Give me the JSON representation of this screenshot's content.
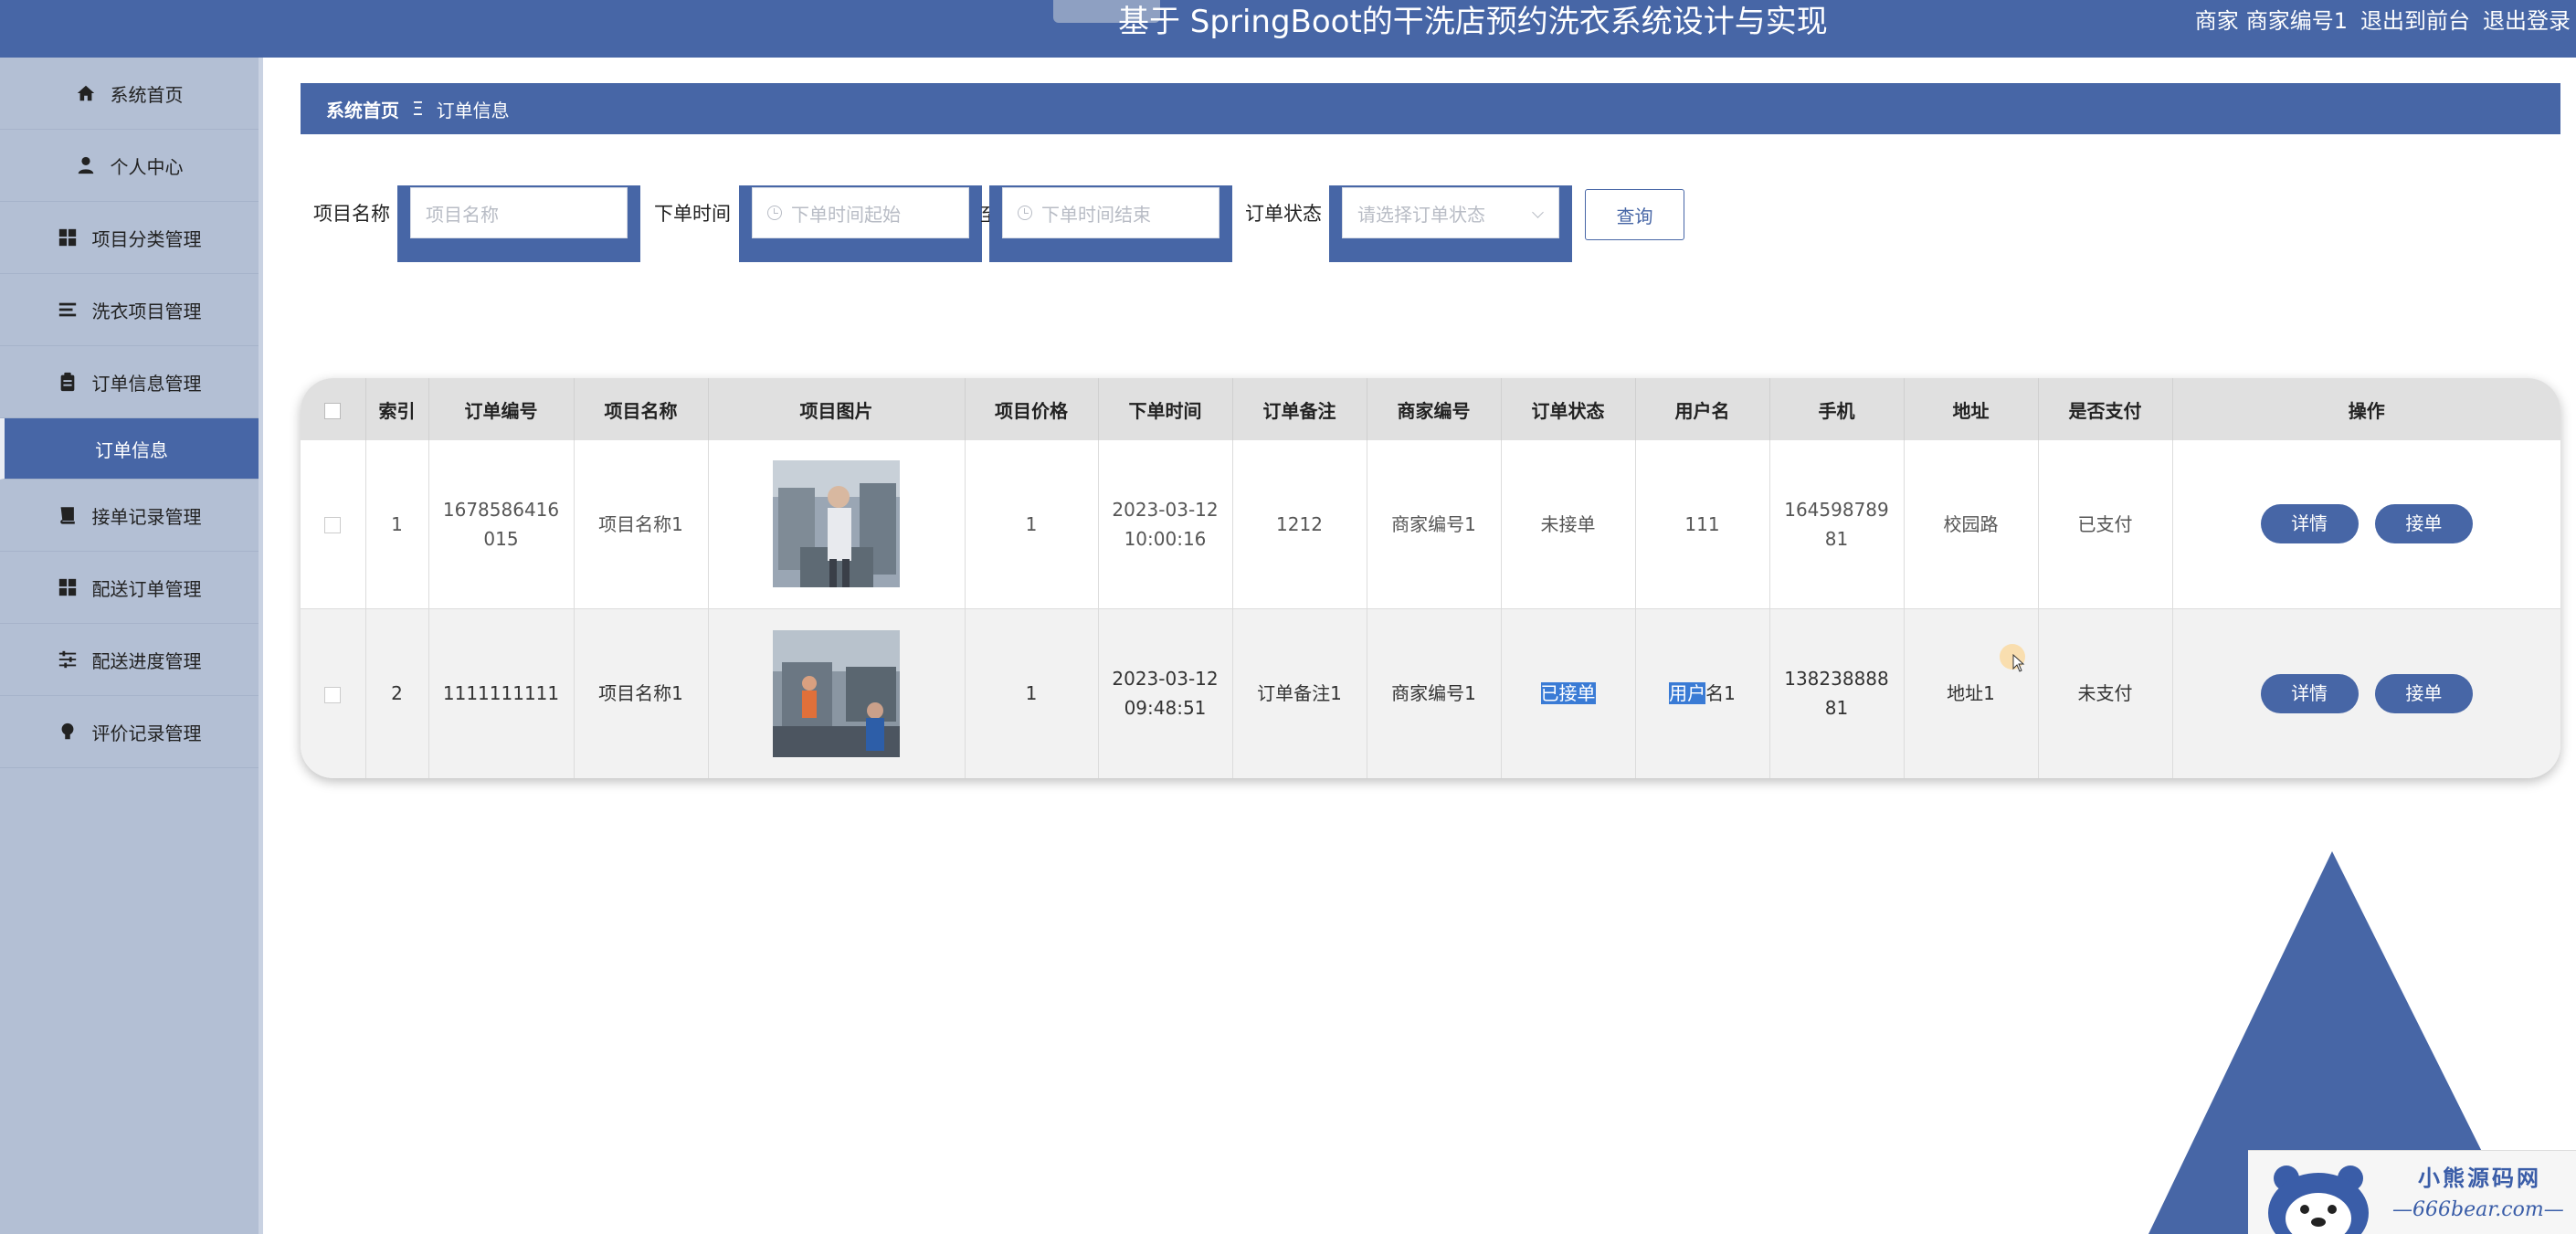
{
  "app": {
    "title": "基于 SpringBoot的干洗店预约洗衣系统设计与实现",
    "user_role": "商家",
    "user_name": "商家编号1",
    "back_to_front": "退出到前台",
    "logout": "退出登录"
  },
  "sidebar": {
    "items": [
      {
        "label": "系统首页",
        "icon": "home-icon"
      },
      {
        "label": "个人中心",
        "icon": "user-icon"
      },
      {
        "label": "项目分类管理",
        "icon": "grid-icon"
      },
      {
        "label": "洗衣项目管理",
        "icon": "list-icon"
      },
      {
        "label": "订单信息管理",
        "icon": "clipboard-icon"
      },
      {
        "label": "订单信息",
        "icon": "",
        "active": true
      },
      {
        "label": "接单记录管理",
        "icon": "book-icon"
      },
      {
        "label": "配送订单管理",
        "icon": "grid-icon"
      },
      {
        "label": "配送进度管理",
        "icon": "sliders-icon"
      },
      {
        "label": "评价记录管理",
        "icon": "bulb-icon"
      }
    ]
  },
  "breadcrumb": {
    "home": "系统首页",
    "separator": "Ξ",
    "current": "订单信息"
  },
  "search": {
    "project_label": "项目名称",
    "project_placeholder": "项目名称",
    "time_label": "下单时间",
    "time_start_placeholder": "下单时间起始",
    "time_end_placeholder": "下单时间结束",
    "status_label": "订单状态",
    "status_placeholder": "请选择订单状态",
    "query_button": "查询"
  },
  "table": {
    "columns": [
      "索引",
      "订单编号",
      "项目名称",
      "项目图片",
      "项目价格",
      "下单时间",
      "订单备注",
      "商家编号",
      "订单状态",
      "用户名",
      "手机",
      "地址",
      "是否支付",
      "操作"
    ],
    "rows": [
      {
        "index": "1",
        "order_no": "1678586416015",
        "project": "项目名称1",
        "price": "1",
        "time": "2023-03-12 10:00:16",
        "note": "1212",
        "merchant": "商家编号1",
        "status": "未接单",
        "username": "111",
        "phone": "16459878981",
        "address": "校园路",
        "paid": "已支付",
        "detail_btn": "详情",
        "accept_btn": "接单"
      },
      {
        "index": "2",
        "order_no": "1111111111",
        "project": "项目名称1",
        "price": "1",
        "time": "2023-03-12 09:48:51",
        "note": "订单备注1",
        "merchant": "商家编号1",
        "status_selected": "已接单",
        "username_selected": "用户",
        "username_rest": "名1",
        "phone": "13823888881",
        "address": "地址1",
        "paid": "未支付",
        "detail_btn": "详情",
        "accept_btn": "接单"
      }
    ]
  },
  "watermark": {
    "title": "小熊源码网",
    "url": "—666bear.com—"
  },
  "colors": {
    "primary": "#4766a6",
    "sidebar": "#b3bfd4",
    "header_row": "#e0e0e0",
    "selection": "#3a7bd5"
  }
}
